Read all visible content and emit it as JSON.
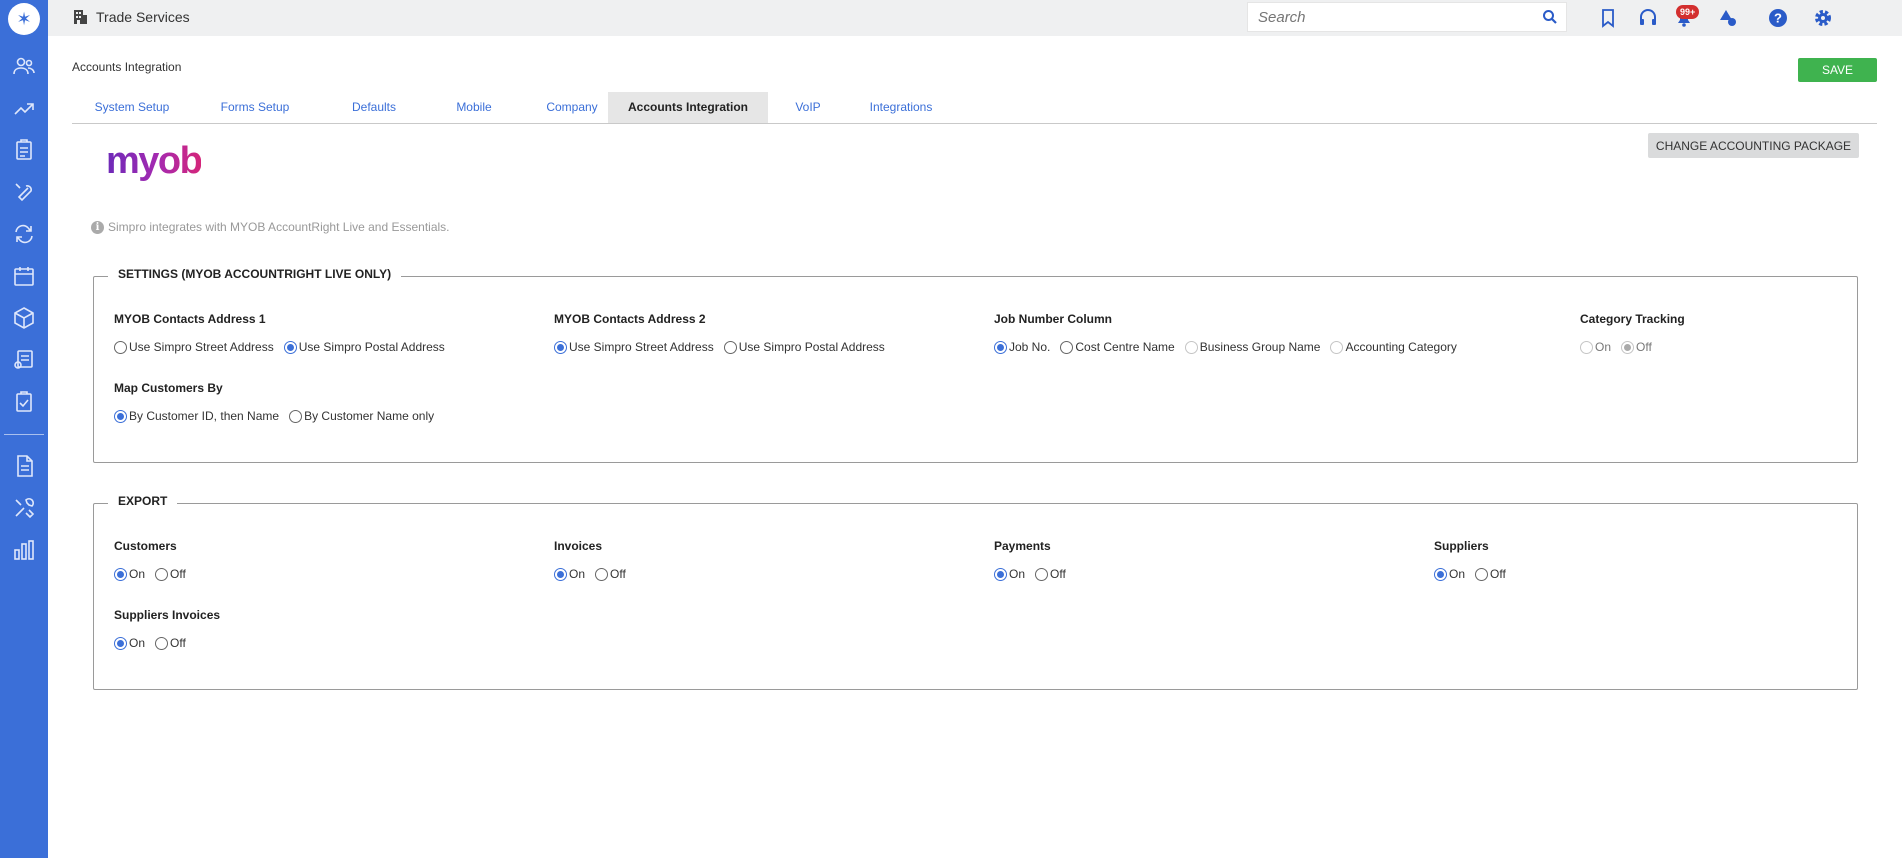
{
  "topbar": {
    "app_name": "Trade Services",
    "search_placeholder": "Search",
    "notification_badge": "99+"
  },
  "page": {
    "title": "Accounts Integration",
    "save_label": "SAVE",
    "change_package_label": "CHANGE ACCOUNTING PACKAGE",
    "logo_text": "myob",
    "info_text": "Simpro integrates with MYOB AccountRight Live and Essentials."
  },
  "tabs": [
    {
      "label": "System Setup"
    },
    {
      "label": "Forms Setup"
    },
    {
      "label": "Defaults"
    },
    {
      "label": "Mobile"
    },
    {
      "label": "Company"
    },
    {
      "label": "Accounts Integration",
      "active": true
    },
    {
      "label": "VoIP"
    },
    {
      "label": "Integrations"
    }
  ],
  "settings": {
    "legend": "SETTINGS (MYOB ACCOUNTRIGHT LIVE ONLY)",
    "contacts_address_1": {
      "label": "MYOB Contacts Address 1",
      "options": [
        "Use Simpro Street Address",
        "Use Simpro Postal Address"
      ],
      "selected": "Use Simpro Postal Address"
    },
    "contacts_address_2": {
      "label": "MYOB Contacts Address 2",
      "options": [
        "Use Simpro Street Address",
        "Use Simpro Postal Address"
      ],
      "selected": "Use Simpro Street Address"
    },
    "job_number_column": {
      "label": "Job Number Column",
      "options": [
        "Job No.",
        "Cost Centre Name",
        "Business Group Name",
        "Accounting Category"
      ],
      "selected": "Job No."
    },
    "category_tracking": {
      "label": "Category Tracking",
      "options": [
        "On",
        "Off"
      ],
      "selected": "Off"
    },
    "map_customers_by": {
      "label": "Map Customers By",
      "options": [
        "By Customer ID, then Name",
        "By Customer Name only"
      ],
      "selected": "By Customer ID, then Name"
    }
  },
  "export": {
    "legend": "EXPORT",
    "customers": {
      "label": "Customers",
      "options": [
        "On",
        "Off"
      ],
      "selected": "On"
    },
    "invoices": {
      "label": "Invoices",
      "options": [
        "On",
        "Off"
      ],
      "selected": "On"
    },
    "payments": {
      "label": "Payments",
      "options": [
        "On",
        "Off"
      ],
      "selected": "On"
    },
    "suppliers": {
      "label": "Suppliers",
      "options": [
        "On",
        "Off"
      ],
      "selected": "On"
    },
    "suppliers_invoices": {
      "label": "Suppliers Invoices",
      "options": [
        "On",
        "Off"
      ],
      "selected": "On"
    }
  },
  "colors": {
    "sidebar": "#3b6fd8",
    "accent": "#3b6fd8",
    "save": "#3fb34f",
    "badge": "#d32f2f"
  },
  "icons": {
    "sidebar": [
      "people-icon",
      "leads-icon",
      "clipboard-icon",
      "wrench-icon",
      "recurring-icon",
      "calendar-icon",
      "box-icon",
      "quotes-icon",
      "checklist-icon",
      "document-icon",
      "tools-icon",
      "reports-icon"
    ],
    "topbar": [
      "building-icon",
      "search-icon",
      "bookmark-icon",
      "headset-icon",
      "bell-icon",
      "shapes-icon",
      "help-icon",
      "gear-icon"
    ]
  }
}
